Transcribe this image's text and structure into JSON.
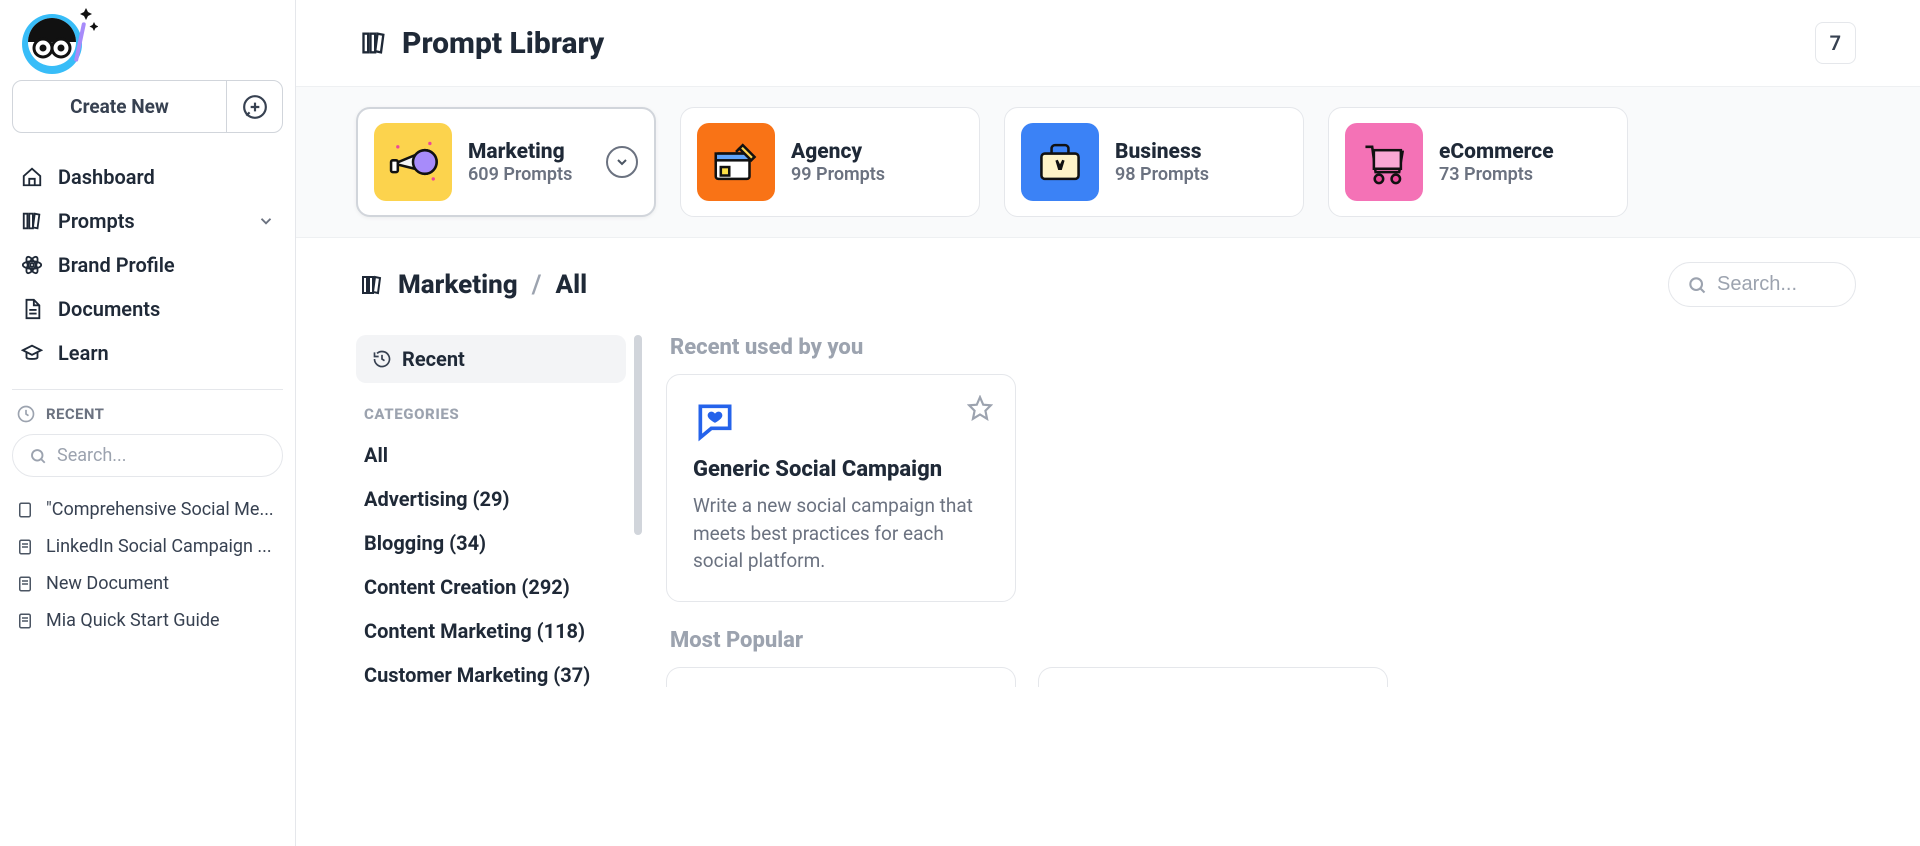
{
  "header": {
    "title": "Prompt Library",
    "right_badge": "7"
  },
  "sidebar": {
    "create_label": "Create New",
    "nav": [
      {
        "icon": "home",
        "label": "Dashboard",
        "expandable": false
      },
      {
        "icon": "library",
        "label": "Prompts",
        "expandable": true
      },
      {
        "icon": "atom",
        "label": "Brand Profile",
        "expandable": false
      },
      {
        "icon": "document",
        "label": "Documents",
        "expandable": false
      },
      {
        "icon": "grad-cap",
        "label": "Learn",
        "expandable": false
      }
    ],
    "recent_heading": "RECENT",
    "search_placeholder": "Search...",
    "recent_docs": [
      "\"Comprehensive Social Me...",
      "LinkedIn Social Campaign ...",
      "New Document",
      "Mia Quick Start Guide"
    ]
  },
  "category_cards": [
    {
      "name": "Marketing",
      "count": "609 Prompts",
      "color": "#fcd34d",
      "active": true
    },
    {
      "name": "Agency",
      "count": "99 Prompts",
      "color": "#f97316",
      "active": false
    },
    {
      "name": "Business",
      "count": "98 Prompts",
      "color": "#3b82f6",
      "active": false
    },
    {
      "name": "eCommerce",
      "count": "73 Prompts",
      "color": "#f472b6",
      "active": false
    }
  ],
  "breadcrumb": {
    "root": "Marketing",
    "leaf": "All"
  },
  "main_search_placeholder": "Search...",
  "category_panel": {
    "recent_label": "Recent",
    "heading": "CATEGORIES",
    "items": [
      "All",
      "Advertising (29)",
      "Blogging (34)",
      "Content Creation (292)",
      "Content Marketing (118)",
      "Customer Marketing (37)"
    ]
  },
  "sections": {
    "recent_title": "Recent used by you",
    "popular_title": "Most Popular"
  },
  "recent_prompt": {
    "title": "Generic Social Campaign",
    "description": "Write a new social campaign that meets best practices for each social platform."
  }
}
